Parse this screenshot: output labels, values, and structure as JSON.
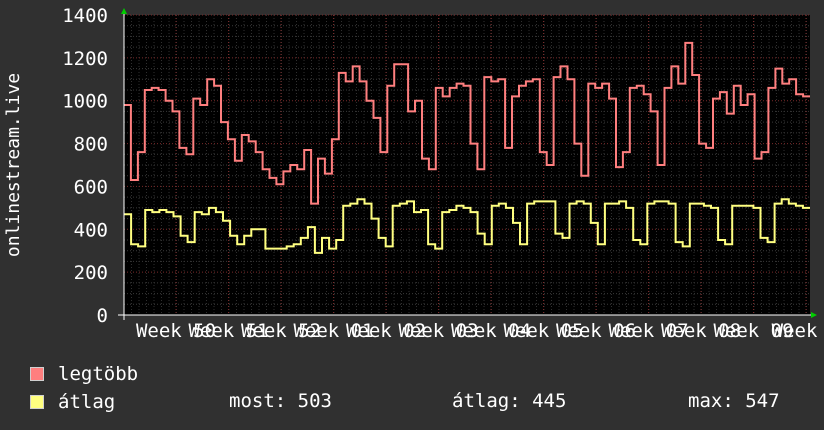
{
  "chart_data": {
    "type": "line",
    "ylabel": "onlinestream.live",
    "ylim": [
      0,
      1400
    ],
    "yticks": [
      "0",
      "200",
      "400",
      "600",
      "800",
      "1000",
      "1200",
      "1400"
    ],
    "xticks": [
      "Week 50",
      "Week 51",
      "Week 52",
      "Week 01",
      "Week 02",
      "Week 03",
      "Week 04",
      "Week 05",
      "Week 06",
      "Week 07",
      "Week 08",
      "Week 09",
      "Week 1"
    ],
    "grid": true,
    "series": [
      {
        "name": "legtöbb",
        "color": "#ff7f7f",
        "values": [
          980,
          630,
          760,
          1050,
          1060,
          1050,
          1000,
          950,
          780,
          750,
          1010,
          980,
          1100,
          1070,
          900,
          820,
          720,
          840,
          810,
          760,
          680,
          640,
          610,
          670,
          700,
          680,
          770,
          520,
          730,
          660,
          820,
          1130,
          1090,
          1160,
          1090,
          1000,
          920,
          760,
          1070,
          1170,
          1170,
          950,
          1000,
          730,
          680,
          1060,
          1020,
          1060,
          1080,
          1070,
          800,
          680,
          1110,
          1090,
          1100,
          780,
          1020,
          1070,
          1090,
          1100,
          760,
          700,
          1110,
          1160,
          1100,
          800,
          650,
          1080,
          1060,
          1080,
          1010,
          690,
          760,
          1060,
          1070,
          1030,
          950,
          700,
          1060,
          1160,
          1080,
          1270,
          1120,
          800,
          780,
          1010,
          1040,
          940,
          1070,
          980,
          1030,
          730,
          760,
          1060,
          1150,
          1080,
          1100,
          1030,
          1020
        ]
      },
      {
        "name": "átlag",
        "color": "#ffff80",
        "values": [
          470,
          330,
          320,
          490,
          480,
          490,
          480,
          460,
          370,
          340,
          480,
          470,
          500,
          480,
          440,
          370,
          330,
          370,
          400,
          400,
          310,
          310,
          310,
          320,
          330,
          360,
          410,
          290,
          360,
          310,
          350,
          510,
          520,
          540,
          520,
          450,
          360,
          320,
          510,
          520,
          530,
          480,
          490,
          330,
          310,
          480,
          490,
          510,
          500,
          480,
          380,
          330,
          510,
          520,
          500,
          430,
          330,
          520,
          530,
          530,
          530,
          380,
          360,
          520,
          530,
          520,
          430,
          330,
          520,
          520,
          530,
          500,
          350,
          330,
          520,
          530,
          530,
          520,
          340,
          320,
          520,
          520,
          510,
          500,
          350,
          330,
          510,
          510,
          510,
          500,
          360,
          340,
          520,
          540,
          520,
          510,
          500
        ]
      }
    ]
  },
  "legend": {
    "items": [
      {
        "label": "legtöbb",
        "color": "#ff7f7f"
      },
      {
        "label": "átlag",
        "color": "#ffff80"
      }
    ]
  },
  "stats": {
    "most": "most: 503",
    "atlag": "átlag: 445",
    "max": "max: 547"
  }
}
